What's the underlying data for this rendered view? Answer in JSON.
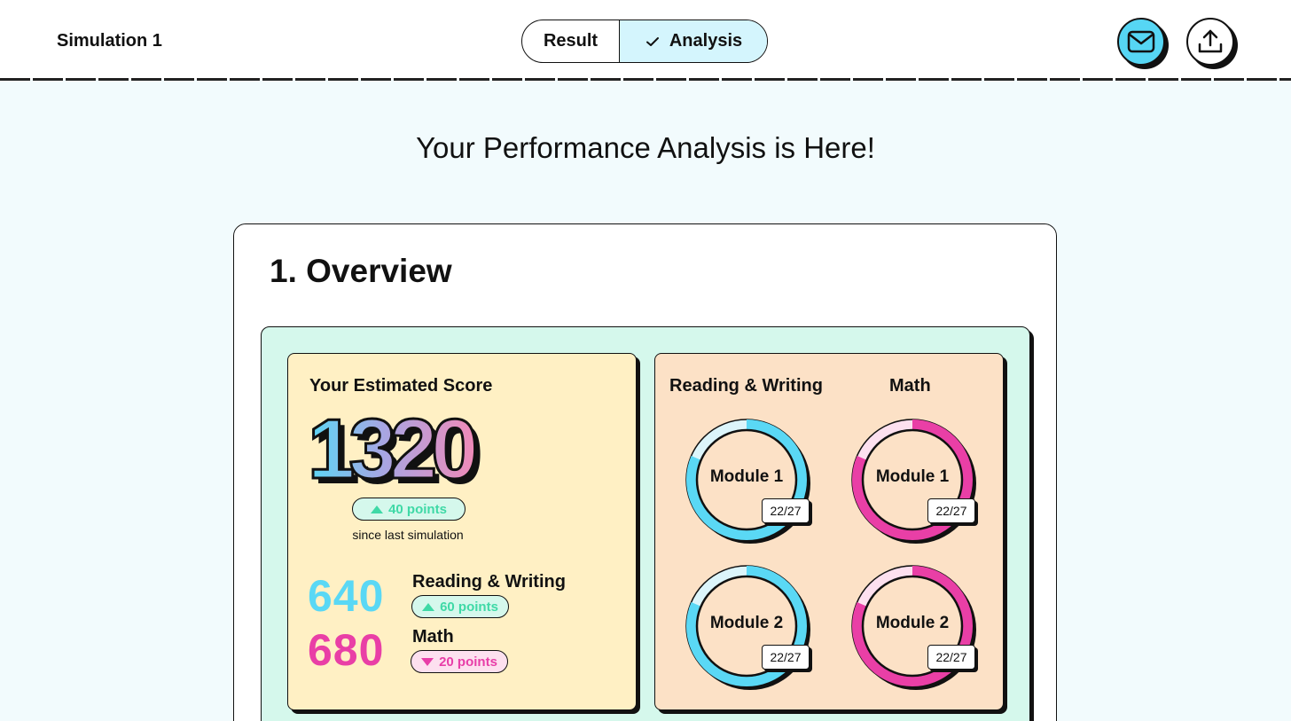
{
  "header": {
    "title": "Simulation 1",
    "tabs": [
      {
        "label": "Result",
        "active": false
      },
      {
        "label": "Analysis",
        "active": true
      }
    ],
    "mail_icon": "mail-icon",
    "share_icon": "share-upload-icon"
  },
  "page": {
    "heading": "Your Performance Analysis is Here!"
  },
  "overview": {
    "title": "1. Overview",
    "estimated_label": "Your Estimated Score",
    "total_score": "1320",
    "total_delta": "40 points",
    "total_delta_direction": "up",
    "since_text": "since last simulation",
    "sections": [
      {
        "name": "Reading & Writing",
        "score": "640",
        "delta": "60 points",
        "direction": "up",
        "color": "#5ad8f5"
      },
      {
        "name": "Math",
        "score": "680",
        "delta": "20 points",
        "direction": "down",
        "color": "#e93fa6"
      }
    ]
  },
  "modules": {
    "columns": [
      "Reading & Writing",
      "Math"
    ],
    "items": [
      {
        "subject": "Reading & Writing",
        "label": "Module 1",
        "count": "22/27",
        "correct": 22,
        "total": 27,
        "color": "#5ad8f5",
        "track": "#dcf5fb"
      },
      {
        "subject": "Math",
        "label": "Module 1",
        "count": "22/27",
        "correct": 22,
        "total": 27,
        "color": "#e93fa6",
        "track": "#fde0ef"
      },
      {
        "subject": "Reading & Writing",
        "label": "Module 2",
        "count": "22/27",
        "correct": 22,
        "total": 27,
        "color": "#5ad8f5",
        "track": "#dcf5fb"
      },
      {
        "subject": "Math",
        "label": "Module 2",
        "count": "22/27",
        "correct": 22,
        "total": 27,
        "color": "#e93fa6",
        "track": "#fde0ef"
      }
    ]
  },
  "colors": {
    "accent_cyan": "#5ad8f5",
    "accent_pink": "#e93fa6",
    "delta_up": "#3fd9a6",
    "panel_green": "#d5f8ec",
    "panel_yellow": "#fff0c4",
    "panel_peach": "#fce1c6"
  }
}
